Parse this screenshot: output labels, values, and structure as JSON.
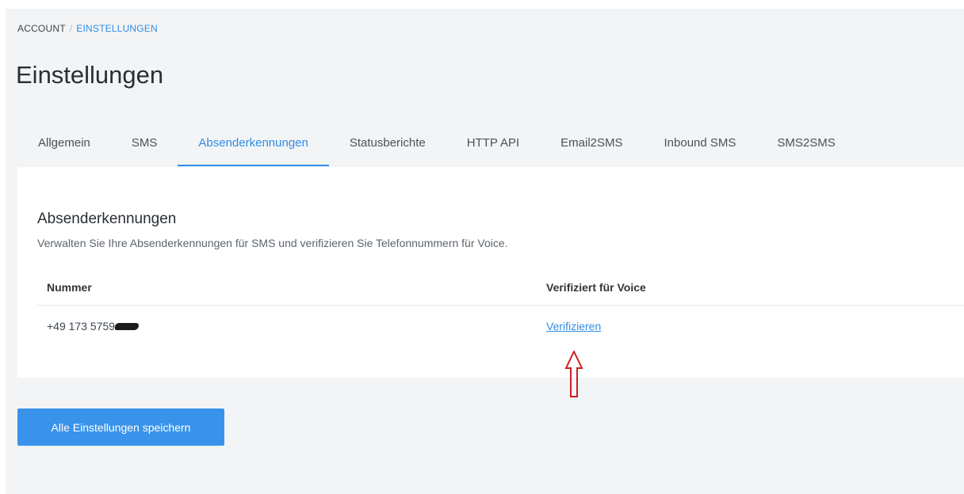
{
  "breadcrumb": {
    "root": "ACCOUNT",
    "separator": "/",
    "current": "EINSTELLUNGEN"
  },
  "page": {
    "title": "Einstellungen"
  },
  "tabs": [
    {
      "label": "Allgemein",
      "active": false
    },
    {
      "label": "SMS",
      "active": false
    },
    {
      "label": "Absenderkennungen",
      "active": true
    },
    {
      "label": "Statusberichte",
      "active": false
    },
    {
      "label": "HTTP API",
      "active": false
    },
    {
      "label": "Email2SMS",
      "active": false
    },
    {
      "label": "Inbound SMS",
      "active": false
    },
    {
      "label": "SMS2SMS",
      "active": false
    }
  ],
  "section": {
    "title": "Absenderkennungen",
    "description": "Verwalten Sie Ihre Absenderkennungen für SMS und verifizieren Sie Telefonnummern für Voice.",
    "columns": {
      "number": "Nummer",
      "voice": "Verifiziert für Voice"
    },
    "rows": [
      {
        "number": "+49 173 5759",
        "voice_action": "Verifizieren"
      }
    ]
  },
  "actions": {
    "save_label": "Alle Einstellungen speichern"
  },
  "icons": {
    "annotation": "arrow-up-outline-icon"
  },
  "colors": {
    "accent": "#2f8de4",
    "button": "#3a93ea",
    "annotation": "#cc1f1f",
    "page_background": "#f2f4f6"
  }
}
